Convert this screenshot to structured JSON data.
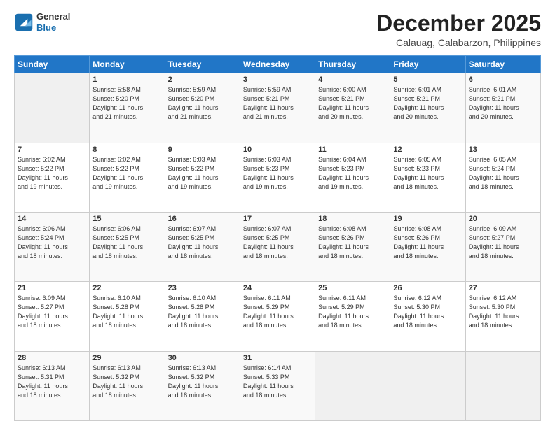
{
  "logo": {
    "line1": "General",
    "line2": "Blue"
  },
  "title": "December 2025",
  "subtitle": "Calauag, Calabarzon, Philippines",
  "header_days": [
    "Sunday",
    "Monday",
    "Tuesday",
    "Wednesday",
    "Thursday",
    "Friday",
    "Saturday"
  ],
  "weeks": [
    [
      {
        "day": "",
        "info": ""
      },
      {
        "day": "1",
        "info": "Sunrise: 5:58 AM\nSunset: 5:20 PM\nDaylight: 11 hours\nand 21 minutes."
      },
      {
        "day": "2",
        "info": "Sunrise: 5:59 AM\nSunset: 5:20 PM\nDaylight: 11 hours\nand 21 minutes."
      },
      {
        "day": "3",
        "info": "Sunrise: 5:59 AM\nSunset: 5:21 PM\nDaylight: 11 hours\nand 21 minutes."
      },
      {
        "day": "4",
        "info": "Sunrise: 6:00 AM\nSunset: 5:21 PM\nDaylight: 11 hours\nand 20 minutes."
      },
      {
        "day": "5",
        "info": "Sunrise: 6:01 AM\nSunset: 5:21 PM\nDaylight: 11 hours\nand 20 minutes."
      },
      {
        "day": "6",
        "info": "Sunrise: 6:01 AM\nSunset: 5:21 PM\nDaylight: 11 hours\nand 20 minutes."
      }
    ],
    [
      {
        "day": "7",
        "info": "Sunrise: 6:02 AM\nSunset: 5:22 PM\nDaylight: 11 hours\nand 19 minutes."
      },
      {
        "day": "8",
        "info": "Sunrise: 6:02 AM\nSunset: 5:22 PM\nDaylight: 11 hours\nand 19 minutes."
      },
      {
        "day": "9",
        "info": "Sunrise: 6:03 AM\nSunset: 5:22 PM\nDaylight: 11 hours\nand 19 minutes."
      },
      {
        "day": "10",
        "info": "Sunrise: 6:03 AM\nSunset: 5:23 PM\nDaylight: 11 hours\nand 19 minutes."
      },
      {
        "day": "11",
        "info": "Sunrise: 6:04 AM\nSunset: 5:23 PM\nDaylight: 11 hours\nand 19 minutes."
      },
      {
        "day": "12",
        "info": "Sunrise: 6:05 AM\nSunset: 5:23 PM\nDaylight: 11 hours\nand 18 minutes."
      },
      {
        "day": "13",
        "info": "Sunrise: 6:05 AM\nSunset: 5:24 PM\nDaylight: 11 hours\nand 18 minutes."
      }
    ],
    [
      {
        "day": "14",
        "info": "Sunrise: 6:06 AM\nSunset: 5:24 PM\nDaylight: 11 hours\nand 18 minutes."
      },
      {
        "day": "15",
        "info": "Sunrise: 6:06 AM\nSunset: 5:25 PM\nDaylight: 11 hours\nand 18 minutes."
      },
      {
        "day": "16",
        "info": "Sunrise: 6:07 AM\nSunset: 5:25 PM\nDaylight: 11 hours\nand 18 minutes."
      },
      {
        "day": "17",
        "info": "Sunrise: 6:07 AM\nSunset: 5:25 PM\nDaylight: 11 hours\nand 18 minutes."
      },
      {
        "day": "18",
        "info": "Sunrise: 6:08 AM\nSunset: 5:26 PM\nDaylight: 11 hours\nand 18 minutes."
      },
      {
        "day": "19",
        "info": "Sunrise: 6:08 AM\nSunset: 5:26 PM\nDaylight: 11 hours\nand 18 minutes."
      },
      {
        "day": "20",
        "info": "Sunrise: 6:09 AM\nSunset: 5:27 PM\nDaylight: 11 hours\nand 18 minutes."
      }
    ],
    [
      {
        "day": "21",
        "info": "Sunrise: 6:09 AM\nSunset: 5:27 PM\nDaylight: 11 hours\nand 18 minutes."
      },
      {
        "day": "22",
        "info": "Sunrise: 6:10 AM\nSunset: 5:28 PM\nDaylight: 11 hours\nand 18 minutes."
      },
      {
        "day": "23",
        "info": "Sunrise: 6:10 AM\nSunset: 5:28 PM\nDaylight: 11 hours\nand 18 minutes."
      },
      {
        "day": "24",
        "info": "Sunrise: 6:11 AM\nSunset: 5:29 PM\nDaylight: 11 hours\nand 18 minutes."
      },
      {
        "day": "25",
        "info": "Sunrise: 6:11 AM\nSunset: 5:29 PM\nDaylight: 11 hours\nand 18 minutes."
      },
      {
        "day": "26",
        "info": "Sunrise: 6:12 AM\nSunset: 5:30 PM\nDaylight: 11 hours\nand 18 minutes."
      },
      {
        "day": "27",
        "info": "Sunrise: 6:12 AM\nSunset: 5:30 PM\nDaylight: 11 hours\nand 18 minutes."
      }
    ],
    [
      {
        "day": "28",
        "info": "Sunrise: 6:13 AM\nSunset: 5:31 PM\nDaylight: 11 hours\nand 18 minutes."
      },
      {
        "day": "29",
        "info": "Sunrise: 6:13 AM\nSunset: 5:32 PM\nDaylight: 11 hours\nand 18 minutes."
      },
      {
        "day": "30",
        "info": "Sunrise: 6:13 AM\nSunset: 5:32 PM\nDaylight: 11 hours\nand 18 minutes."
      },
      {
        "day": "31",
        "info": "Sunrise: 6:14 AM\nSunset: 5:33 PM\nDaylight: 11 hours\nand 18 minutes."
      },
      {
        "day": "",
        "info": ""
      },
      {
        "day": "",
        "info": ""
      },
      {
        "day": "",
        "info": ""
      }
    ]
  ]
}
